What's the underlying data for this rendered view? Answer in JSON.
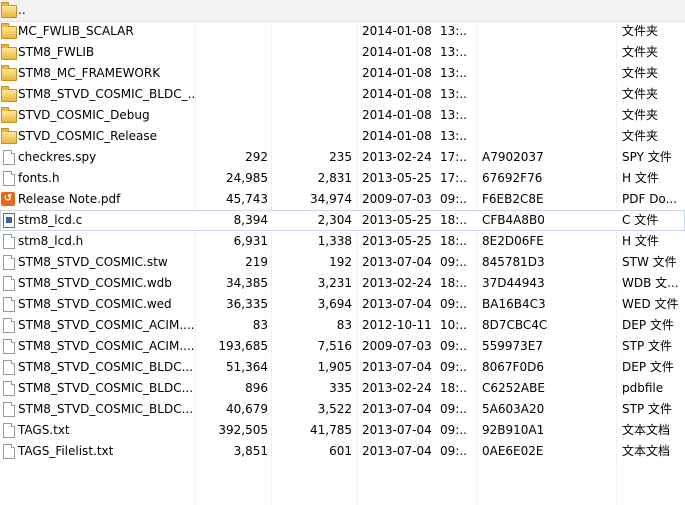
{
  "files": [
    {
      "icon": "folder-icon",
      "name": "..",
      "size": "",
      "packed": "",
      "date": "",
      "time": "",
      "crc": "",
      "type": ""
    },
    {
      "icon": "folder-icon",
      "name": "MC_FWLIB_SCALAR",
      "size": "",
      "packed": "",
      "date": "2014-01-08",
      "time": "13:...",
      "crc": "",
      "type": "文件夹"
    },
    {
      "icon": "folder-icon",
      "name": "STM8_FWLIB",
      "size": "",
      "packed": "",
      "date": "2014-01-08",
      "time": "13:...",
      "crc": "",
      "type": "文件夹"
    },
    {
      "icon": "folder-icon",
      "name": "STM8_MC_FRAMEWORK",
      "size": "",
      "packed": "",
      "date": "2014-01-08",
      "time": "13:...",
      "crc": "",
      "type": "文件夹"
    },
    {
      "icon": "folder-icon",
      "name": "STM8_STVD_COSMIC_BLDC_...",
      "size": "",
      "packed": "",
      "date": "2014-01-08",
      "time": "13:...",
      "crc": "",
      "type": "文件夹"
    },
    {
      "icon": "folder-icon",
      "name": "STVD_COSMIC_Debug",
      "size": "",
      "packed": "",
      "date": "2014-01-08",
      "time": "13:...",
      "crc": "",
      "type": "文件夹"
    },
    {
      "icon": "folder-icon",
      "name": "STVD_COSMIC_Release",
      "size": "",
      "packed": "",
      "date": "2014-01-08",
      "time": "13:...",
      "crc": "",
      "type": "文件夹"
    },
    {
      "icon": "file-icon",
      "name": "checkres.spy",
      "size": "292",
      "packed": "235",
      "date": "2013-02-24",
      "time": "17:...",
      "crc": "A7902037",
      "type": "SPY 文件"
    },
    {
      "icon": "file-icon",
      "name": "fonts.h",
      "size": "24,985",
      "packed": "2,831",
      "date": "2013-05-25",
      "time": "17:...",
      "crc": "67692F76",
      "type": "H 文件"
    },
    {
      "icon": "pdf-icon",
      "name": "Release Note.pdf",
      "size": "45,743",
      "packed": "34,974",
      "date": "2009-07-03",
      "time": "09:...",
      "crc": "F6EB2C8E",
      "type": "PDF Do..."
    },
    {
      "icon": "c-file-icon",
      "name": "stm8_lcd.c",
      "size": "8,394",
      "packed": "2,304",
      "date": "2013-05-25",
      "time": "18:...",
      "crc": "CFB4A8B0",
      "type": "C 文件"
    },
    {
      "icon": "file-icon",
      "name": "stm8_lcd.h",
      "size": "6,931",
      "packed": "1,338",
      "date": "2013-05-25",
      "time": "18:...",
      "crc": "8E2D06FE",
      "type": "H 文件"
    },
    {
      "icon": "file-icon",
      "name": "STM8_STVD_COSMIC.stw",
      "size": "219",
      "packed": "192",
      "date": "2013-07-04",
      "time": "09:...",
      "crc": "845781D3",
      "type": "STW 文件"
    },
    {
      "icon": "file-icon",
      "name": "STM8_STVD_COSMIC.wdb",
      "size": "34,385",
      "packed": "3,231",
      "date": "2013-02-24",
      "time": "18:...",
      "crc": "37D44943",
      "type": "WDB 文..."
    },
    {
      "icon": "file-icon",
      "name": "STM8_STVD_COSMIC.wed",
      "size": "36,335",
      "packed": "3,694",
      "date": "2013-07-04",
      "time": "09:...",
      "crc": "BA16B4C3",
      "type": "WED 文件"
    },
    {
      "icon": "file-icon",
      "name": "STM8_STVD_COSMIC_ACIM....",
      "size": "83",
      "packed": "83",
      "date": "2012-10-11",
      "time": "10:...",
      "crc": "8D7CBC4C",
      "type": "DEP 文件"
    },
    {
      "icon": "file-icon",
      "name": "STM8_STVD_COSMIC_ACIM....",
      "size": "193,685",
      "packed": "7,516",
      "date": "2009-07-03",
      "time": "09:...",
      "crc": "559973E7",
      "type": "STP 文件"
    },
    {
      "icon": "file-icon",
      "name": "STM8_STVD_COSMIC_BLDC....",
      "size": "51,364",
      "packed": "1,905",
      "date": "2013-07-04",
      "time": "09:...",
      "crc": "8067F0D6",
      "type": "DEP 文件"
    },
    {
      "icon": "file-icon",
      "name": "STM8_STVD_COSMIC_BLDC....",
      "size": "896",
      "packed": "335",
      "date": "2013-02-24",
      "time": "18:...",
      "crc": "C6252ABE",
      "type": "pdbfile"
    },
    {
      "icon": "file-icon",
      "name": "STM8_STVD_COSMIC_BLDC....",
      "size": "40,679",
      "packed": "3,522",
      "date": "2013-07-04",
      "time": "09:...",
      "crc": "5A603A20",
      "type": "STP 文件"
    },
    {
      "icon": "file-icon",
      "name": "TAGS.txt",
      "size": "392,505",
      "packed": "41,785",
      "date": "2013-07-04",
      "time": "09:...",
      "crc": "92B910A1",
      "type": "文本文档"
    },
    {
      "icon": "file-icon",
      "name": "TAGS_Filelist.txt",
      "size": "3,851",
      "packed": "601",
      "date": "2013-07-04",
      "time": "09:...",
      "crc": "0AE6E02E",
      "type": "文本文档"
    }
  ]
}
